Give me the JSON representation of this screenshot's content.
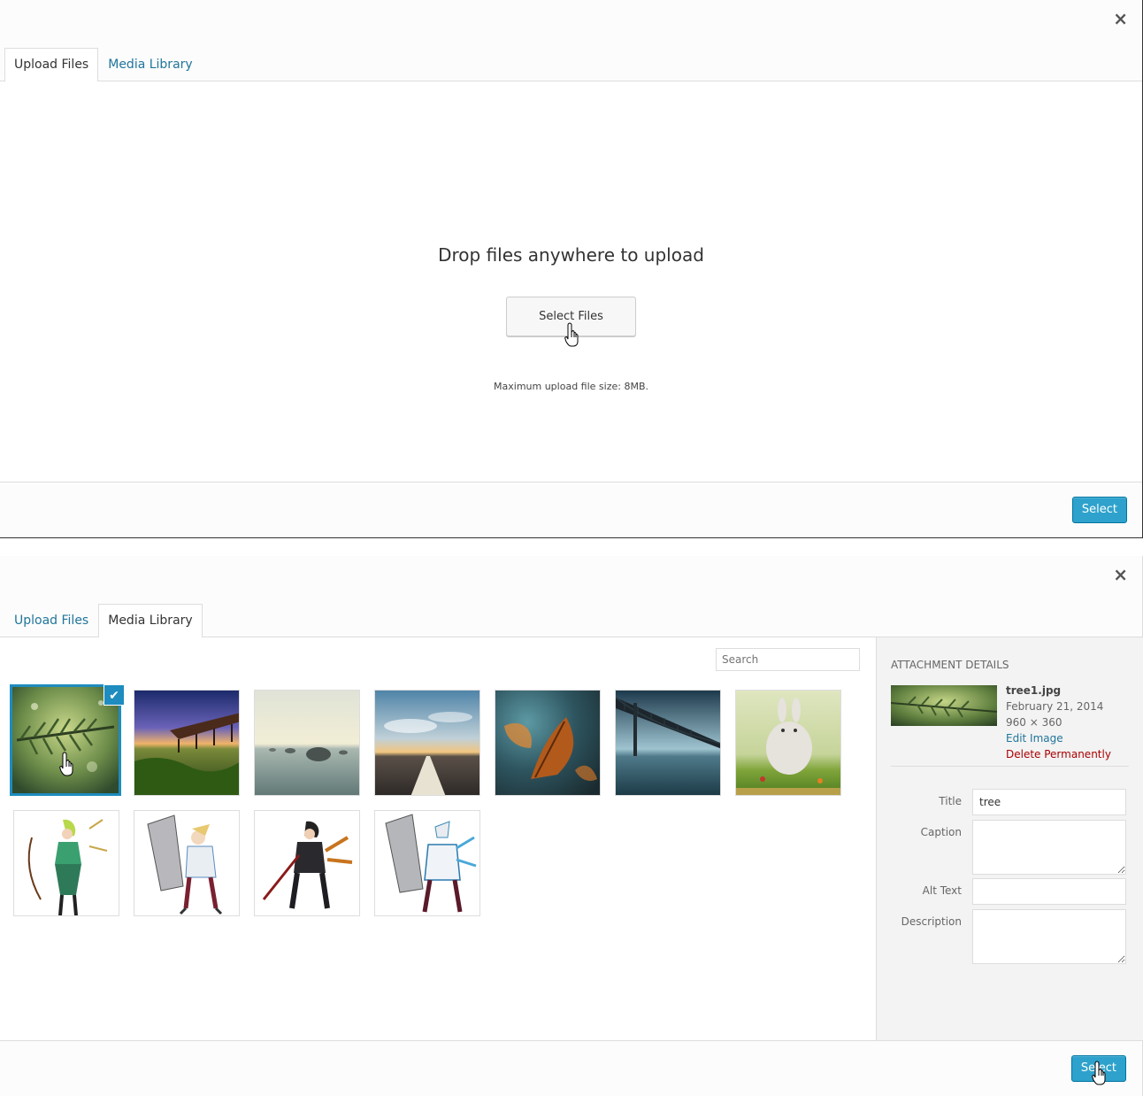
{
  "modal_upload": {
    "close_label": "×",
    "tabs": [
      {
        "label": "Upload Files"
      },
      {
        "label": "Media Library"
      }
    ],
    "drop_title": "Drop files anywhere to upload",
    "select_files_label": "Select Files",
    "max_upload": "Maximum upload file size: 8MB.",
    "select_button": "Select"
  },
  "modal_library": {
    "close_label": "×",
    "tabs": [
      {
        "label": "Upload Files"
      },
      {
        "label": "Media Library"
      }
    ],
    "search_placeholder": "Search",
    "thumbnails": [
      {
        "name": "tree",
        "selected": true
      },
      {
        "name": "field-sunset"
      },
      {
        "name": "calm-sea-rocks"
      },
      {
        "name": "road-clouds"
      },
      {
        "name": "autumn-leaf"
      },
      {
        "name": "bridge"
      },
      {
        "name": "big-buck-bunny"
      },
      {
        "name": "archer-character"
      },
      {
        "name": "white-armor-character"
      },
      {
        "name": "dark-swordsman-character"
      },
      {
        "name": "mecha-armor-character"
      }
    ],
    "attachment": {
      "heading": "Attachment Details",
      "filename": "tree1.jpg",
      "date": "February 21, 2014",
      "dimensions": "960 × 360",
      "edit_link": "Edit Image",
      "delete_link": "Delete Permanently"
    },
    "fields": {
      "title_label": "Title",
      "title_value": "tree",
      "caption_label": "Caption",
      "alt_label": "Alt Text",
      "description_label": "Description"
    },
    "select_button": "Select"
  },
  "colors": {
    "primary": "#2ea2cc",
    "link": "#21759b",
    "delete": "#aa0000",
    "selected_border": "#1e8cbe"
  }
}
